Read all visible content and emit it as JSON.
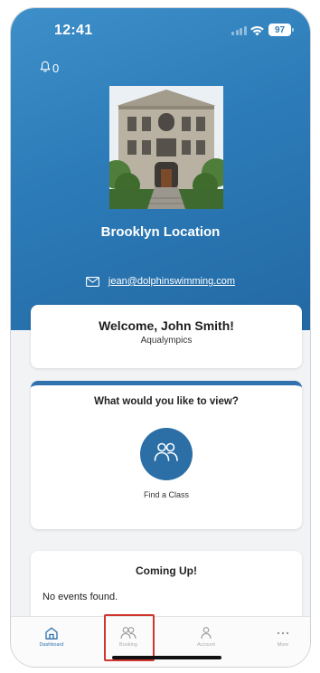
{
  "status_bar": {
    "time": "12:41",
    "battery": "97"
  },
  "header": {
    "notification_count": "0",
    "location_name": "Brooklyn Location",
    "email": "jean@dolphinswimming.com"
  },
  "welcome": {
    "title": "Welcome, John Smith!",
    "subtitle": "Aqualympics"
  },
  "view": {
    "title": "What would you like to view?",
    "find_class_label": "Find a Class"
  },
  "coming_up": {
    "title": "Coming Up!",
    "empty_text": "No events found."
  },
  "tabs": [
    {
      "label": "Dashboard",
      "icon": "home-icon"
    },
    {
      "label": "Booking",
      "icon": "people-icon"
    },
    {
      "label": "Account",
      "icon": "person-icon"
    },
    {
      "label": "More",
      "icon": "ellipsis-icon"
    }
  ],
  "colors": {
    "brand_blue": "#2c7bb8",
    "button_blue": "#2b6fa6",
    "highlight_red": "#d0362f"
  }
}
